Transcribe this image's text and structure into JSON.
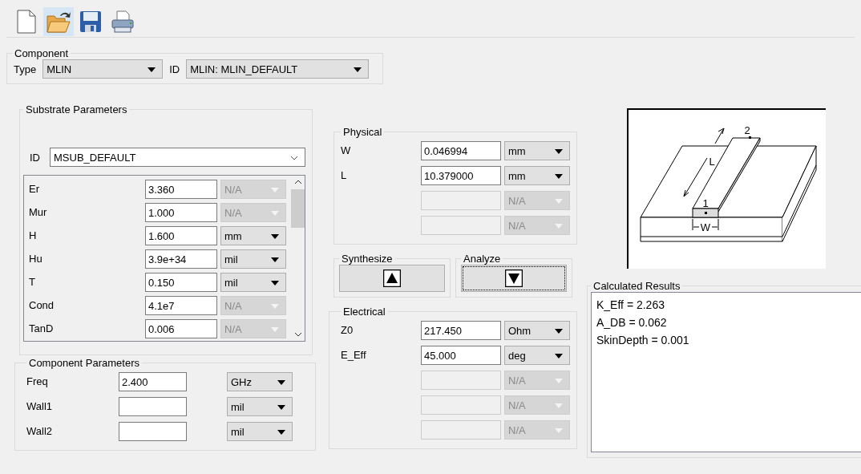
{
  "toolbar": [
    {
      "kind": "new",
      "highlighted": false
    },
    {
      "kind": "open",
      "highlighted": true
    },
    {
      "kind": "save",
      "highlighted": false
    },
    {
      "kind": "print",
      "highlighted": false
    }
  ],
  "component": {
    "title": "Component",
    "type_label": "Type",
    "type_value": "MLIN",
    "id_label": "ID",
    "id_value": "MLIN: MLIN_DEFAULT"
  },
  "substrate": {
    "title": "Substrate Parameters",
    "id_label": "ID",
    "id_value": "MSUB_DEFAULT",
    "rows": [
      {
        "label": "Er",
        "value": "3.360",
        "unit": "N/A",
        "unit_disabled": true
      },
      {
        "label": "Mur",
        "value": "1.000",
        "unit": "N/A",
        "unit_disabled": true
      },
      {
        "label": "H",
        "value": "1.600",
        "unit": "mm",
        "unit_disabled": false
      },
      {
        "label": "Hu",
        "value": "3.9e+34",
        "unit": "mil",
        "unit_disabled": false
      },
      {
        "label": "T",
        "value": "0.150",
        "unit": "mil",
        "unit_disabled": false
      },
      {
        "label": "Cond",
        "value": "4.1e7",
        "unit": "N/A",
        "unit_disabled": true
      },
      {
        "label": "TanD",
        "value": "0.006",
        "unit": "N/A",
        "unit_disabled": true
      }
    ]
  },
  "component_params": {
    "title": "Component Parameters",
    "rows": [
      {
        "label": "Freq",
        "value": "2.400",
        "unit": "GHz"
      },
      {
        "label": "Wall1",
        "value": "",
        "unit": "mil"
      },
      {
        "label": "Wall2",
        "value": "",
        "unit": "mil"
      }
    ]
  },
  "physical": {
    "title": "Physical",
    "rows": [
      {
        "label": "W",
        "value": "0.046994",
        "unit": "mm",
        "disabled": false
      },
      {
        "label": "L",
        "value": "10.379000",
        "unit": "mm",
        "disabled": false
      },
      {
        "unit": "N/A",
        "disabled": true
      },
      {
        "unit": "N/A",
        "disabled": true
      }
    ]
  },
  "synthesize": {
    "title": "Synthesize",
    "focused": false
  },
  "analyze": {
    "title": "Analyze",
    "focused": true
  },
  "electrical": {
    "title": "Electrical",
    "rows": [
      {
        "label": "Z0",
        "value": "217.450",
        "unit": "Ohm",
        "disabled": false
      },
      {
        "label": "E_Eff",
        "value": "45.000",
        "unit": "deg",
        "disabled": false
      },
      {
        "unit": "N/A",
        "disabled": true
      },
      {
        "unit": "N/A",
        "disabled": true
      },
      {
        "unit": "N/A",
        "disabled": true
      }
    ]
  },
  "diagram": {
    "length_label": "L",
    "width_label": "W",
    "port1": "1",
    "port2": "2"
  },
  "results": {
    "title": "Calculated Results",
    "lines": [
      "K_Eff = 2.263",
      "A_DB = 0.062",
      "SkinDepth = 0.001"
    ]
  }
}
